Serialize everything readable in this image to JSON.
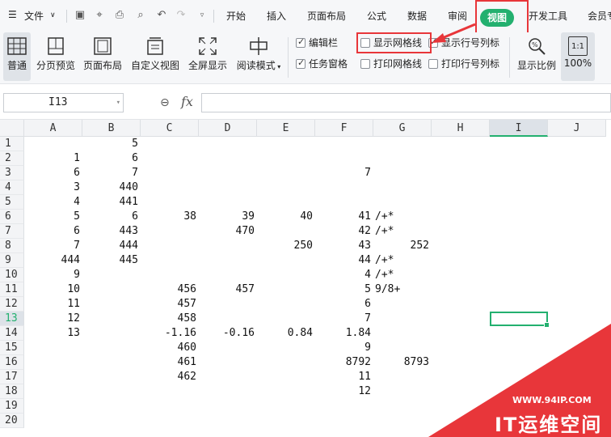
{
  "menu": {
    "file": "文件",
    "tabs": [
      "开始",
      "插入",
      "页面布局",
      "公式",
      "数据",
      "审阅",
      "视图",
      "开发工具",
      "会员专"
    ],
    "active_tab": "视图"
  },
  "toolbar": {
    "buttons": [
      "普通",
      "分页预览",
      "页面布局",
      "自定义视图",
      "全屏显示",
      "阅读模式"
    ],
    "checkboxes": [
      {
        "label": "编辑栏",
        "checked": true
      },
      {
        "label": "任务窗格",
        "checked": true
      },
      {
        "label": "显示网格线",
        "checked": false
      },
      {
        "label": "打印网格线",
        "checked": false
      },
      {
        "label": "显示行号列标",
        "checked": true
      },
      {
        "label": "打印行号列标",
        "checked": false
      }
    ],
    "zoom_label": "显示比例",
    "zoom_ratio_icon": "1:1",
    "zoom_value": "100%"
  },
  "formula_bar": {
    "name_box": "I13",
    "fx": "fx",
    "content": ""
  },
  "sheet": {
    "columns": [
      "A",
      "B",
      "C",
      "D",
      "E",
      "F",
      "G",
      "H",
      "I",
      "J"
    ],
    "selected_column": "I",
    "rows": [
      "1",
      "2",
      "3",
      "4",
      "5",
      "6",
      "7",
      "8",
      "9",
      "10",
      "11",
      "12",
      "13",
      "14",
      "15",
      "16",
      "17",
      "18",
      "19",
      "20"
    ],
    "selected_row": "13",
    "selected_cell": "I13",
    "cells": [
      {
        "r": 1,
        "c": "B",
        "v": "5"
      },
      {
        "r": 2,
        "c": "A",
        "v": "1"
      },
      {
        "r": 2,
        "c": "B",
        "v": "6"
      },
      {
        "r": 3,
        "c": "A",
        "v": "6"
      },
      {
        "r": 3,
        "c": "B",
        "v": "7"
      },
      {
        "r": 3,
        "c": "F",
        "v": "7"
      },
      {
        "r": 4,
        "c": "A",
        "v": "3"
      },
      {
        "r": 4,
        "c": "B",
        "v": "440"
      },
      {
        "r": 5,
        "c": "A",
        "v": "4"
      },
      {
        "r": 5,
        "c": "B",
        "v": "441"
      },
      {
        "r": 6,
        "c": "A",
        "v": "5"
      },
      {
        "r": 6,
        "c": "B",
        "v": "6"
      },
      {
        "r": 6,
        "c": "C",
        "v": "38"
      },
      {
        "r": 6,
        "c": "D",
        "v": "39"
      },
      {
        "r": 6,
        "c": "E",
        "v": "40"
      },
      {
        "r": 6,
        "c": "F",
        "v": "41"
      },
      {
        "r": 6,
        "c": "G",
        "v": "/+*",
        "text": true
      },
      {
        "r": 7,
        "c": "A",
        "v": "6"
      },
      {
        "r": 7,
        "c": "B",
        "v": "443"
      },
      {
        "r": 7,
        "c": "D",
        "v": "470"
      },
      {
        "r": 7,
        "c": "F",
        "v": "42"
      },
      {
        "r": 7,
        "c": "G",
        "v": "/+*",
        "text": true
      },
      {
        "r": 8,
        "c": "A",
        "v": "7"
      },
      {
        "r": 8,
        "c": "B",
        "v": "444"
      },
      {
        "r": 8,
        "c": "E",
        "v": "250"
      },
      {
        "r": 8,
        "c": "F",
        "v": "43"
      },
      {
        "r": 8,
        "c": "G",
        "v": "252"
      },
      {
        "r": 9,
        "c": "A",
        "v": "444"
      },
      {
        "r": 9,
        "c": "B",
        "v": "445"
      },
      {
        "r": 9,
        "c": "F",
        "v": "44"
      },
      {
        "r": 9,
        "c": "G",
        "v": "/+*",
        "text": true
      },
      {
        "r": 10,
        "c": "A",
        "v": "9"
      },
      {
        "r": 10,
        "c": "F",
        "v": "4"
      },
      {
        "r": 10,
        "c": "G",
        "v": "/+*",
        "text": true
      },
      {
        "r": 11,
        "c": "A",
        "v": "10"
      },
      {
        "r": 11,
        "c": "C",
        "v": "456"
      },
      {
        "r": 11,
        "c": "D",
        "v": "457"
      },
      {
        "r": 11,
        "c": "F",
        "v": "5"
      },
      {
        "r": 11,
        "c": "G",
        "v": "9/8+",
        "text": true
      },
      {
        "r": 12,
        "c": "A",
        "v": "11"
      },
      {
        "r": 12,
        "c": "C",
        "v": "457"
      },
      {
        "r": 12,
        "c": "F",
        "v": "6"
      },
      {
        "r": 13,
        "c": "A",
        "v": "12"
      },
      {
        "r": 13,
        "c": "C",
        "v": "458"
      },
      {
        "r": 13,
        "c": "F",
        "v": "7"
      },
      {
        "r": 14,
        "c": "A",
        "v": "13"
      },
      {
        "r": 14,
        "c": "C",
        "v": "-1.16"
      },
      {
        "r": 14,
        "c": "D",
        "v": "-0.16"
      },
      {
        "r": 14,
        "c": "E",
        "v": "0.84"
      },
      {
        "r": 14,
        "c": "F",
        "v": "1.84"
      },
      {
        "r": 15,
        "c": "C",
        "v": "460"
      },
      {
        "r": 15,
        "c": "F",
        "v": "9"
      },
      {
        "r": 16,
        "c": "C",
        "v": "461"
      },
      {
        "r": 16,
        "c": "F",
        "v": "8792"
      },
      {
        "r": 16,
        "c": "G",
        "v": "8793"
      },
      {
        "r": 17,
        "c": "C",
        "v": "462"
      },
      {
        "r": 17,
        "c": "F",
        "v": "11"
      },
      {
        "r": 18,
        "c": "F",
        "v": "12"
      }
    ]
  },
  "watermark": {
    "url": "WWW.94IP.COM",
    "name": "IT运维空间"
  },
  "colors": {
    "accent": "#23b06f",
    "highlight": "#e8363a"
  }
}
